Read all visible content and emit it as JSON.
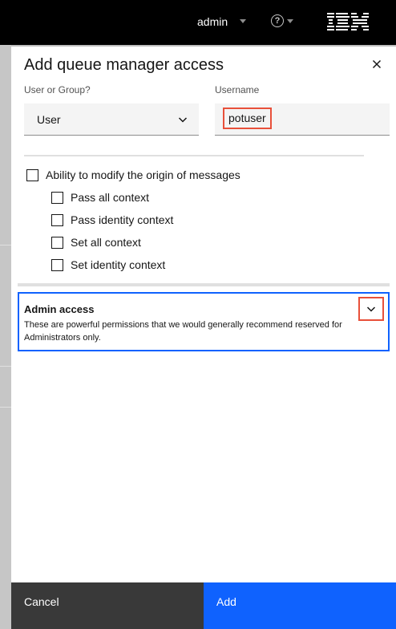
{
  "header": {
    "user_label": "admin",
    "help_icon": "help-icon",
    "logo_text": "IBM"
  },
  "modal": {
    "title": "Add queue manager access",
    "close_icon": "close-icon",
    "user_or_group": {
      "label": "User or Group?",
      "value": "User"
    },
    "username": {
      "label": "Username",
      "value": "potuser"
    },
    "origin_permissions": {
      "label": "Ability to modify the origin of messages",
      "options": [
        "Pass all context",
        "Pass identity context",
        "Set all context",
        "Set identity context"
      ]
    },
    "admin_access": {
      "title": "Admin access",
      "description": "These are powerful permissions that we would generally recommend reserved for Administrators only."
    },
    "buttons": {
      "cancel": "Cancel",
      "add": "Add"
    }
  },
  "colors": {
    "primary": "#0f62fe",
    "header_bg": "#000000",
    "highlight": "#e8503a",
    "secondary_button": "#393939"
  }
}
